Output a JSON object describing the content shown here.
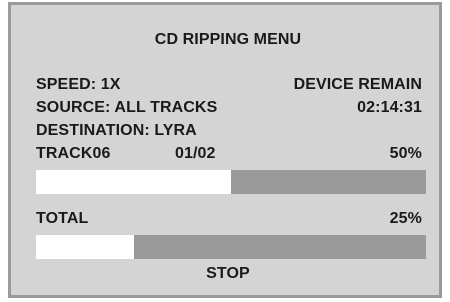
{
  "menu": {
    "title": "CD RIPPING MENU",
    "speed": "SPEED: 1X",
    "source": "SOURCE: ALL TRACKS",
    "destination": "DESTINATION: LYRA",
    "device_remain_label": "DEVICE REMAIN",
    "device_remain_time": "02:14:31",
    "track": {
      "name": "TRACK06",
      "count": "01/02",
      "percent": "50%",
      "progress": 0.5
    },
    "total": {
      "label": "TOTAL",
      "percent": "25%",
      "progress": 0.25
    },
    "stop_label": "STOP"
  },
  "colors": {
    "background": "#d4d4d4",
    "progress_fill": "#ffffff",
    "progress_track": "#9a9a9a",
    "text": "#1a1a1a"
  }
}
